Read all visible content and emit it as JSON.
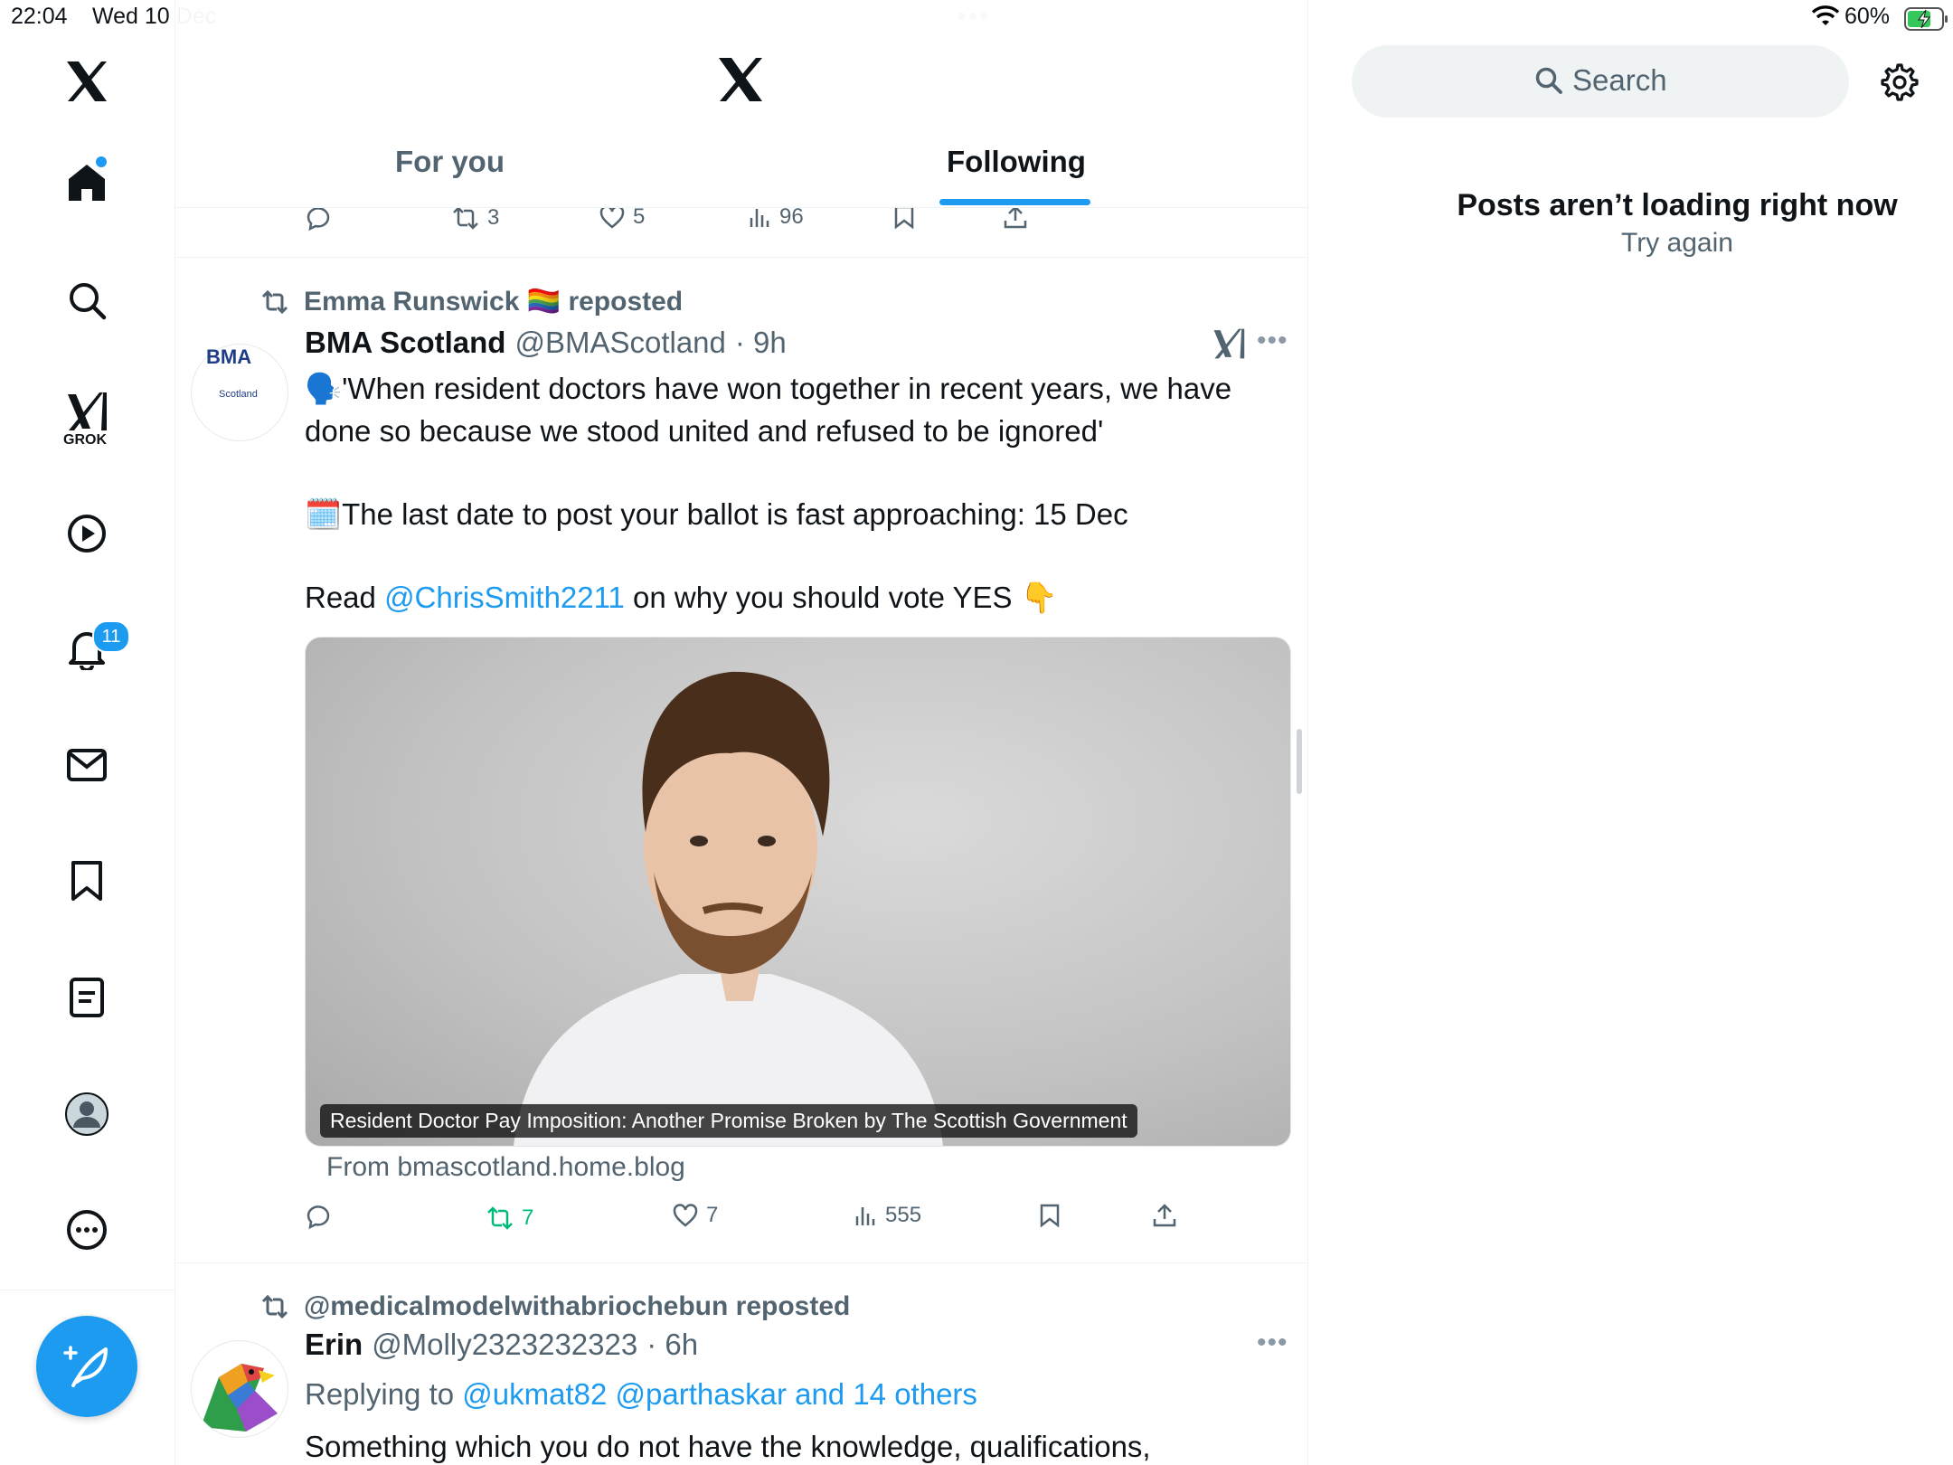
{
  "status_bar": {
    "time": "22:04",
    "date": "Wed 10 Dec",
    "battery": "60%"
  },
  "sidebar": {
    "items": [
      {
        "name": "x-logo-icon"
      },
      {
        "name": "home-icon"
      },
      {
        "name": "search-icon"
      },
      {
        "name": "grok-icon",
        "label": "GROK"
      },
      {
        "name": "video-icon"
      },
      {
        "name": "notifications-icon",
        "badge": "11"
      },
      {
        "name": "messages-icon"
      },
      {
        "name": "bookmarks-icon"
      },
      {
        "name": "lists-icon"
      },
      {
        "name": "profile-icon"
      },
      {
        "name": "more-icon"
      }
    ],
    "compose": "compose-icon"
  },
  "header": {
    "tabs": [
      "For you",
      "Following"
    ],
    "active_tab": "Following"
  },
  "previous_post_actions": {
    "reposts": "3",
    "likes": "5",
    "views": "96"
  },
  "posts": [
    {
      "repost_by": "Emma Runswick 🏳️‍🌈 reposted",
      "name": "BMA Scotland",
      "handle": "@BMAScotland",
      "time": "· 9h",
      "avatar_text": "BMA",
      "avatar_sub": "Scotland",
      "text_line1": "🗣️'When resident doctors have won together in recent years, we have",
      "text_line2": "done so because we stood united and refused to be ignored'",
      "text_para2": "🗓️The last date to post your ballot is fast approaching: 15 Dec",
      "text_para3_prefix": "Read ",
      "text_para3_mention": "@ChrisSmith2211",
      "text_para3_suffix": " on why you should vote YES 👇",
      "card_caption": "Resident Doctor Pay Imposition: Another Promise Broken by The Scottish Government",
      "card_source": "From bmascotland.home.blog",
      "reposts": "7",
      "likes": "7",
      "views": "555"
    },
    {
      "repost_by": "@medicalmodelwithabriochebun reposted",
      "name": "Erin",
      "handle": "@Molly2323232323",
      "time": "· 6h",
      "replying_prefix": "Replying to",
      "replying_to": "@ukmat82 @parthaskar and 14 others",
      "text": "Something which you do not have the knowledge, qualifications,"
    }
  ],
  "right": {
    "search_placeholder": "Search",
    "error_title": "Posts aren’t loading right now",
    "error_retry": "Try again"
  },
  "colors": {
    "accent": "#1d9bf0",
    "repost_active": "#00ba7c",
    "secondary_text": "#536471"
  }
}
